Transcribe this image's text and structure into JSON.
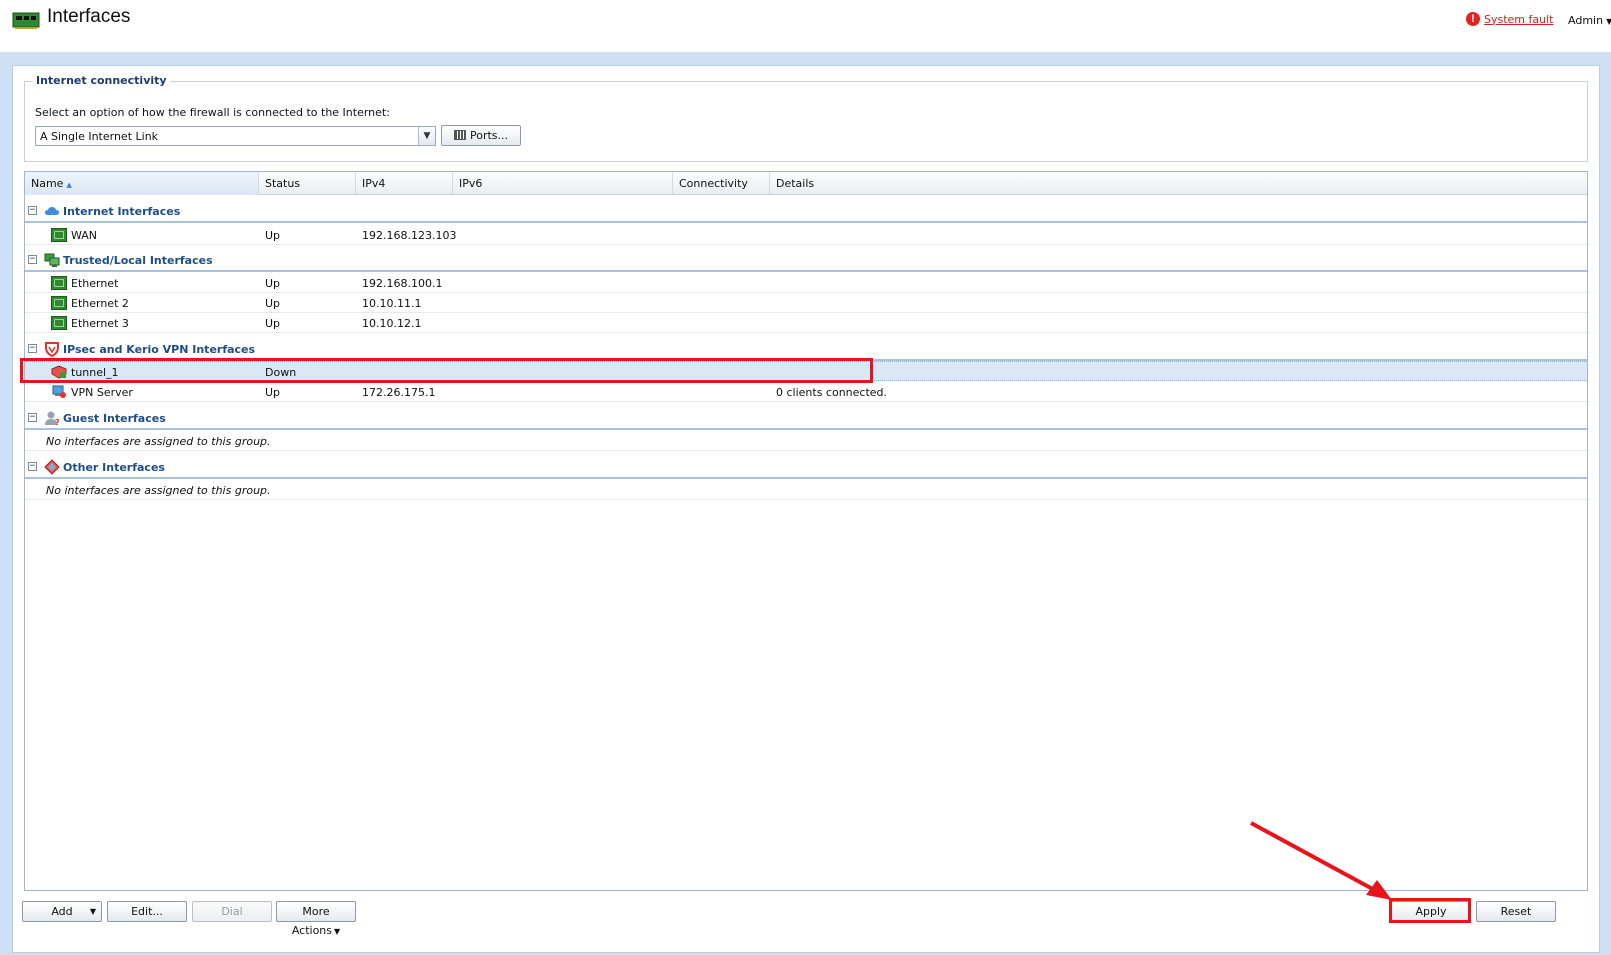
{
  "header": {
    "title": "Interfaces",
    "fault_link": "System fault",
    "user_menu": "Admin"
  },
  "connectivity": {
    "legend": "Internet connectivity",
    "description": "Select an option of how the firewall is connected to the Internet:",
    "selected_option": "A Single Internet Link",
    "ports_button": "Ports..."
  },
  "grid": {
    "columns": [
      "Name",
      "Status",
      "IPv4",
      "IPv6",
      "Connectivity",
      "Details"
    ],
    "sorted_column": "Name",
    "groups": [
      {
        "label": "Internet Interfaces",
        "icon": "cloud-icon",
        "rows": [
          {
            "name": "WAN",
            "status": "Up",
            "ipv4": "192.168.123.103",
            "details": "",
            "icon": "network-card-icon"
          }
        ]
      },
      {
        "label": "Trusted/Local Interfaces",
        "icon": "computers-icon",
        "rows": [
          {
            "name": "Ethernet",
            "status": "Up",
            "ipv4": "192.168.100.1",
            "details": "",
            "icon": "network-card-icon"
          },
          {
            "name": "Ethernet 2",
            "status": "Up",
            "ipv4": "10.10.11.1",
            "details": "",
            "icon": "network-card-icon"
          },
          {
            "name": "Ethernet 3",
            "status": "Up",
            "ipv4": "10.10.12.1",
            "details": "",
            "icon": "network-card-icon"
          }
        ]
      },
      {
        "label": "IPsec and Kerio VPN Interfaces",
        "icon": "shield-icon",
        "rows": [
          {
            "name": "tunnel_1",
            "status": "Down",
            "ipv4": "",
            "details": "",
            "icon": "vpn-tunnel-icon"
          },
          {
            "name": "VPN Server",
            "status": "Up",
            "ipv4": "172.26.175.1",
            "details": "0 clients connected.",
            "icon": "vpn-server-icon"
          }
        ]
      },
      {
        "label": "Guest Interfaces",
        "icon": "guest-user-icon",
        "empty_text": "No interfaces are assigned to this group."
      },
      {
        "label": "Other Interfaces",
        "icon": "other-interfaces-icon",
        "empty_text": "No interfaces are assigned to this group."
      }
    ]
  },
  "toolbar": {
    "add": "Add",
    "edit": "Edit...",
    "dial": "Dial",
    "more_actions": "More Actions",
    "apply": "Apply",
    "reset": "Reset"
  },
  "colors": {
    "accent_blue": "#1f4d8a",
    "annotation_red": "#e8141b",
    "selection": "#dbe7f6",
    "band": "#cfe0f4"
  }
}
